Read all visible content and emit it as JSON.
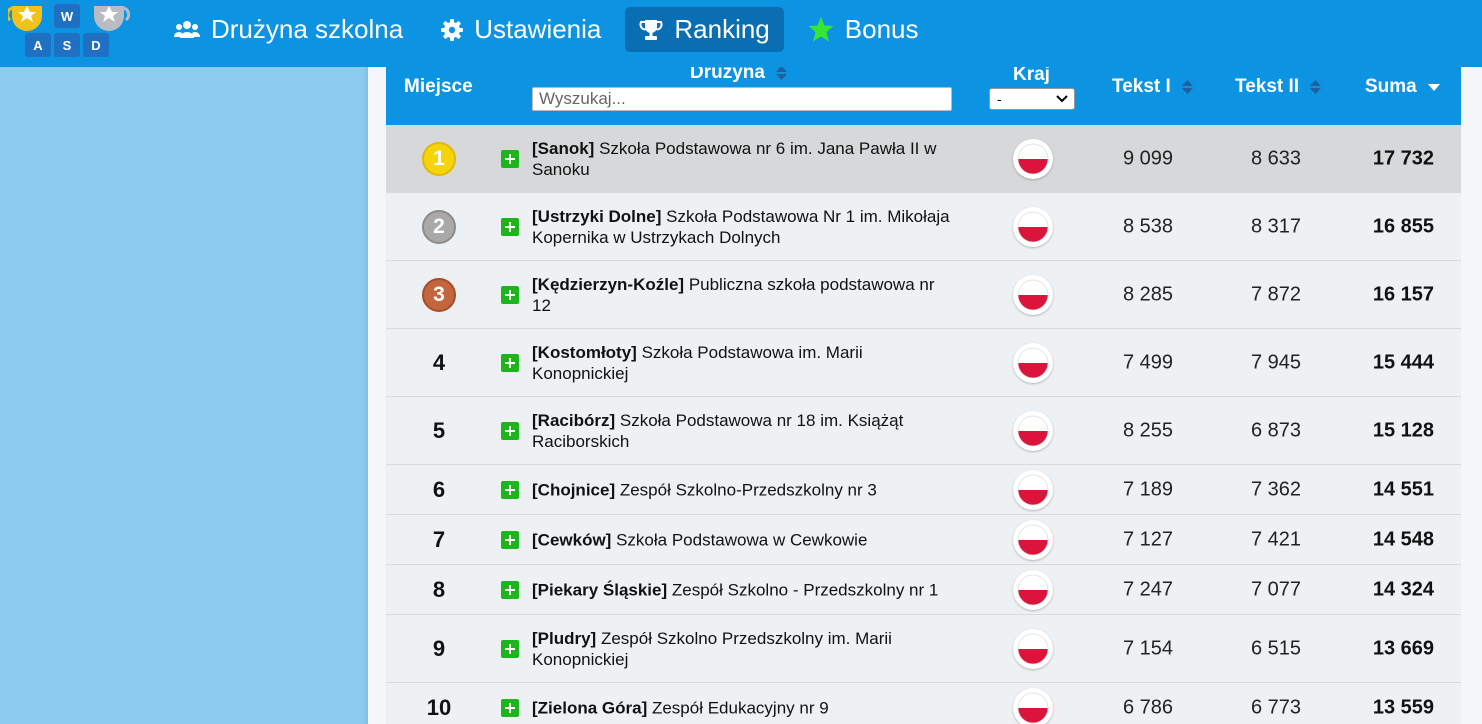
{
  "nav": {
    "items": [
      {
        "label": "Drużyna szkolna",
        "icon": "users-icon",
        "active": false
      },
      {
        "label": "Ustawienia",
        "icon": "gear-icon",
        "active": false
      },
      {
        "label": "Ranking",
        "icon": "trophy-icon",
        "active": true
      },
      {
        "label": "Bonus",
        "icon": "star-icon",
        "active": false
      }
    ]
  },
  "logo": {
    "letters": [
      "W",
      "A",
      "S",
      "D"
    ]
  },
  "table": {
    "headers": {
      "place": "Miejsce",
      "team": "Drużyna",
      "country": "Kraj",
      "text1": "Tekst I",
      "text2": "Tekst II",
      "sum": "Suma"
    },
    "search_placeholder": "Wyszukaj...",
    "country_filter_value": "-",
    "rows": [
      {
        "place": "1",
        "city": "[Sanok]",
        "school": "Szkoła Podstawowa nr 6 im. Jana Pawła II w Sanoku",
        "t1": "9 099",
        "t2": "8 633",
        "sum": "17 732"
      },
      {
        "place": "2",
        "city": "[Ustrzyki Dolne]",
        "school": "Szkoła Podstawowa Nr 1 im. Mikołaja Kopernika w Ustrzykach Dolnych",
        "t1": "8 538",
        "t2": "8 317",
        "sum": "16 855"
      },
      {
        "place": "3",
        "city": "[Kędzierzyn-Koźle]",
        "school": "Publiczna szkoła podstawowa nr 12",
        "t1": "8 285",
        "t2": "7 872",
        "sum": "16 157"
      },
      {
        "place": "4",
        "city": "[Kostomłoty]",
        "school": "Szkoła Podstawowa im. Marii Konopnickiej",
        "t1": "7 499",
        "t2": "7 945",
        "sum": "15 444"
      },
      {
        "place": "5",
        "city": "[Racibórz]",
        "school": "Szkoła Podstawowa nr 18 im. Książąt Raciborskich",
        "t1": "8 255",
        "t2": "6 873",
        "sum": "15 128"
      },
      {
        "place": "6",
        "city": "[Chojnice]",
        "school": "Zespół Szkolno-Przedszkolny nr 3",
        "t1": "7 189",
        "t2": "7 362",
        "sum": "14 551"
      },
      {
        "place": "7",
        "city": "[Cewków]",
        "school": "Szkoła Podstawowa w Cewkowie",
        "t1": "7 127",
        "t2": "7 421",
        "sum": "14 548"
      },
      {
        "place": "8",
        "city": "[Piekary Śląskie]",
        "school": "Zespół Szkolno - Przedszkolny nr 1",
        "t1": "7 247",
        "t2": "7 077",
        "sum": "14 324"
      },
      {
        "place": "9",
        "city": "[Pludry]",
        "school": "Zespół Szkolno Przedszkolny im. Marii Konopnickiej",
        "t1": "7 154",
        "t2": "6 515",
        "sum": "13 669"
      },
      {
        "place": "10",
        "city": "[Zielona Góra]",
        "school": "Zespół Edukacyjny nr 9",
        "t1": "6 786",
        "t2": "6 773",
        "sum": "13 559"
      }
    ]
  },
  "colors": {
    "topbar": "#0c93e2",
    "nav_active": "#0a6fb2",
    "page_bg": "#8ccbf0",
    "gold": "#f5d40c",
    "silver": "#a9a9a9",
    "bronze": "#c4663d",
    "plus_green": "#1cb51c",
    "flag_red": "#dc143c"
  }
}
